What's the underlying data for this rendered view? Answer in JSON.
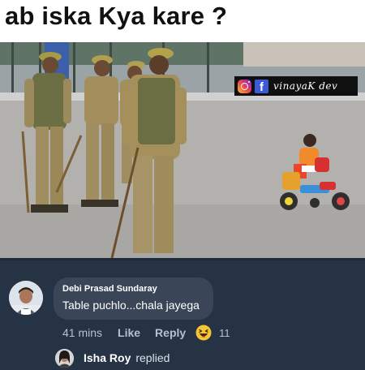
{
  "meme": {
    "caption": "ab iska Kya kare ?",
    "watermark_handle": "vinayaK dev",
    "watermark_icons": [
      "instagram-icon",
      "facebook-icon"
    ]
  },
  "comment": {
    "author": "Debi Prasad Sundaray",
    "text": "Table puchlo...chala jayega",
    "time": "41 mins",
    "like_label": "Like",
    "reply_label": "Reply",
    "reaction_icon": "haha-emoji-icon",
    "reaction_count": "11"
  },
  "reply_summary": {
    "author": "Isha Roy",
    "verb": "replied"
  },
  "colors": {
    "comment_background": "#253345",
    "bubble": "#3a4657",
    "muted_text": "#b8c0cc",
    "reaction_yellow": "#f7c531"
  }
}
